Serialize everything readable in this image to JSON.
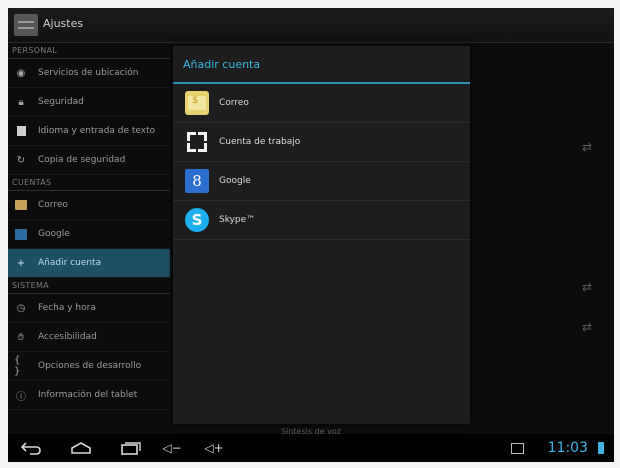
{
  "actionbar": {
    "title": "Ajustes"
  },
  "settings": {
    "sections": [
      {
        "header": "PERSONAL",
        "items": [
          {
            "label": "Servicios de ubicación",
            "icon": "location-icon"
          },
          {
            "label": "Seguridad",
            "icon": "lock-icon"
          },
          {
            "label": "Idioma y entrada de texto",
            "icon": "language-icon"
          },
          {
            "label": "Copia de seguridad",
            "icon": "backup-icon"
          }
        ]
      },
      {
        "header": "CUENTAS",
        "items": [
          {
            "label": "Correo",
            "icon": "mail-icon"
          },
          {
            "label": "Google",
            "icon": "google-icon"
          },
          {
            "label": "Añadir cuenta",
            "icon": "plus-icon"
          }
        ]
      },
      {
        "header": "SISTEMA",
        "items": [
          {
            "label": "Fecha y hora",
            "icon": "clock-icon"
          },
          {
            "label": "Accesibilidad",
            "icon": "accessibility-icon"
          },
          {
            "label": "Opciones de desarrollo",
            "icon": "braces-icon"
          },
          {
            "label": "Información del tablet",
            "icon": "info-icon"
          }
        ]
      }
    ],
    "footer_text": "Síntesis de voz"
  },
  "dialog": {
    "title": "Añadir cuenta",
    "options": [
      {
        "label": "Correo",
        "icon": "mail-icon"
      },
      {
        "label": "Cuenta de trabajo",
        "icon": "work-account-icon"
      },
      {
        "label": "Google",
        "icon": "google-icon"
      },
      {
        "label": "Skype™",
        "icon": "skype-icon"
      }
    ]
  },
  "systembar": {
    "time": "11:03"
  },
  "colors": {
    "accent": "#33b5e5",
    "selected_row": "#1f4f63",
    "background": "#0c0c0c"
  }
}
